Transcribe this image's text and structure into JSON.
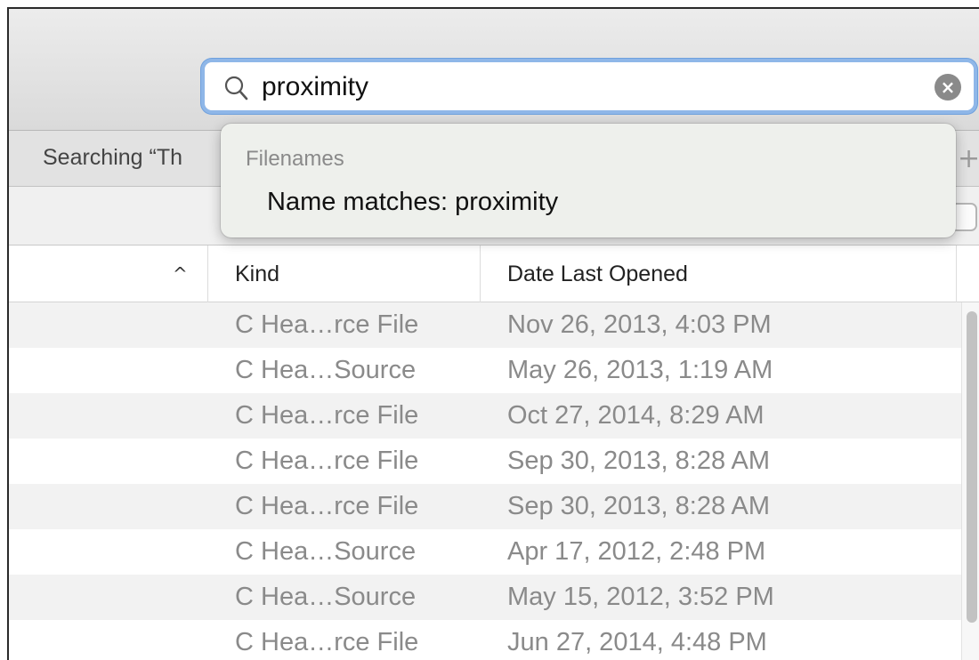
{
  "search": {
    "value": "proximity",
    "search_icon": "search-icon",
    "clear_icon": "clear-icon"
  },
  "scope": {
    "label": "Searching “Th",
    "add_icon": "add-icon",
    "add_glyph": "+"
  },
  "suggestions": {
    "section_label": "Filenames",
    "items": [
      {
        "label": "Name matches: proximity"
      }
    ]
  },
  "table": {
    "sort_indicator": "^",
    "columns": {
      "kind": "Kind",
      "date": "Date Last Opened"
    },
    "rows": [
      {
        "kind": "C Hea…rce File",
        "date": "Nov 26, 2013, 4:03 PM"
      },
      {
        "kind": "C Hea…Source",
        "date": "May 26, 2013, 1:19 AM"
      },
      {
        "kind": "C Hea…rce File",
        "date": "Oct 27, 2014, 8:29 AM"
      },
      {
        "kind": "C Hea…rce File",
        "date": "Sep 30, 2013, 8:28 AM"
      },
      {
        "kind": "C Hea…rce File",
        "date": "Sep 30, 2013, 8:28 AM"
      },
      {
        "kind": "C Hea…Source",
        "date": "Apr 17, 2012, 2:48 PM"
      },
      {
        "kind": "C Hea…Source",
        "date": "May 15, 2012, 3:52 PM"
      },
      {
        "kind": "C Hea…rce File",
        "date": "Jun 27, 2014, 4:48 PM"
      }
    ]
  },
  "colors": {
    "focus_ring": "#8fb7e8",
    "toolbar": "#dadada",
    "row_alt": "#f2f2f2",
    "muted_text": "#8a8a8a"
  }
}
